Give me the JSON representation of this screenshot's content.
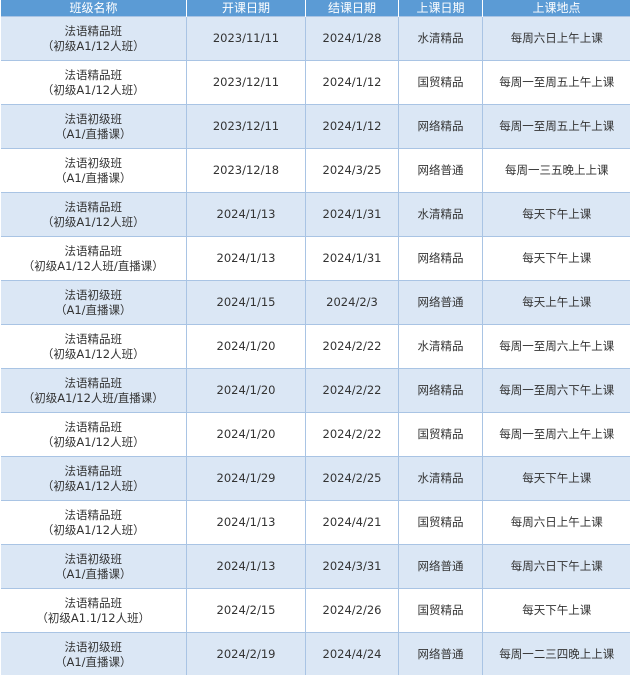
{
  "headers": [
    "班级名称",
    "开课日期",
    "结课日期",
    "上课日期",
    "上课地点"
  ],
  "rows": [
    {
      "name_line1": "法语精品班",
      "name_line2": "（初级A1/12人班）",
      "start": "2023/11/11",
      "end": "2024/1/28",
      "venue": "水清精品",
      "time": "每周六日上午上课"
    },
    {
      "name_line1": "法语精品班",
      "name_line2": "（初级A1/12人班）",
      "start": "2023/12/11",
      "end": "2024/1/12",
      "venue": "国贸精品",
      "time": "每周一至周五上午上课"
    },
    {
      "name_line1": "法语初级班",
      "name_line2": "（A1/直播课）",
      "start": "2023/12/11",
      "end": "2024/1/12",
      "venue": "网络精品",
      "time": "每周一至周五上午上课"
    },
    {
      "name_line1": "法语初级班",
      "name_line2": "（A1/直播课）",
      "start": "2023/12/18",
      "end": "2024/3/25",
      "venue": "网络普通",
      "time": "每周一三五晚上上课"
    },
    {
      "name_line1": "法语精品班",
      "name_line2": "（初级A1/12人班）",
      "start": "2024/1/13",
      "end": "2024/1/31",
      "venue": "水清精品",
      "time": "每天下午上课"
    },
    {
      "name_line1": "法语精品班",
      "name_line2": "（初级A1/12人班/直播课）",
      "start": "2024/1/13",
      "end": "2024/1/31",
      "venue": "网络精品",
      "time": "每天下午上课"
    },
    {
      "name_line1": "法语初级班",
      "name_line2": "（A1/直播课）",
      "start": "2024/1/15",
      "end": "2024/2/3",
      "venue": "网络普通",
      "time": "每天上午上课"
    },
    {
      "name_line1": "法语精品班",
      "name_line2": "（初级A1/12人班）",
      "start": "2024/1/20",
      "end": "2024/2/22",
      "venue": "水清精品",
      "time": "每周一至周六上午上课"
    },
    {
      "name_line1": "法语精品班",
      "name_line2": "（初级A1/12人班/直播课）",
      "start": "2024/1/20",
      "end": "2024/2/22",
      "venue": "网络精品",
      "time": "每周一至周六下午上课"
    },
    {
      "name_line1": "法语精品班",
      "name_line2": "（初级A1/12人班）",
      "start": "2024/1/20",
      "end": "2024/2/22",
      "venue": "国贸精品",
      "time": "每周一至周六上午上课"
    },
    {
      "name_line1": "法语精品班",
      "name_line2": "（初级A1/12人班）",
      "start": "2024/1/29",
      "end": "2024/2/25",
      "venue": "水清精品",
      "time": "每天下午上课"
    },
    {
      "name_line1": "法语精品班",
      "name_line2": "（初级A1/12人班）",
      "start": "2024/1/13",
      "end": "2024/4/21",
      "venue": "国贸精品",
      "time": "每周六日上午上课"
    },
    {
      "name_line1": "法语初级班",
      "name_line2": "（A1/直播课）",
      "start": "2024/1/13",
      "end": "2024/3/31",
      "venue": "网络普通",
      "time": "每周六日下午上课"
    },
    {
      "name_line1": "法语精品班",
      "name_line2": "（初级A1.1/12人班）",
      "start": "2024/2/15",
      "end": "2024/2/26",
      "venue": "国贸精品",
      "time": "每天下午上课"
    },
    {
      "name_line1": "法语初级班",
      "name_line2": "（A1/直播课）",
      "start": "2024/2/19",
      "end": "2024/4/24",
      "venue": "网络普通",
      "time": "每周一二三四晚上上课"
    }
  ]
}
